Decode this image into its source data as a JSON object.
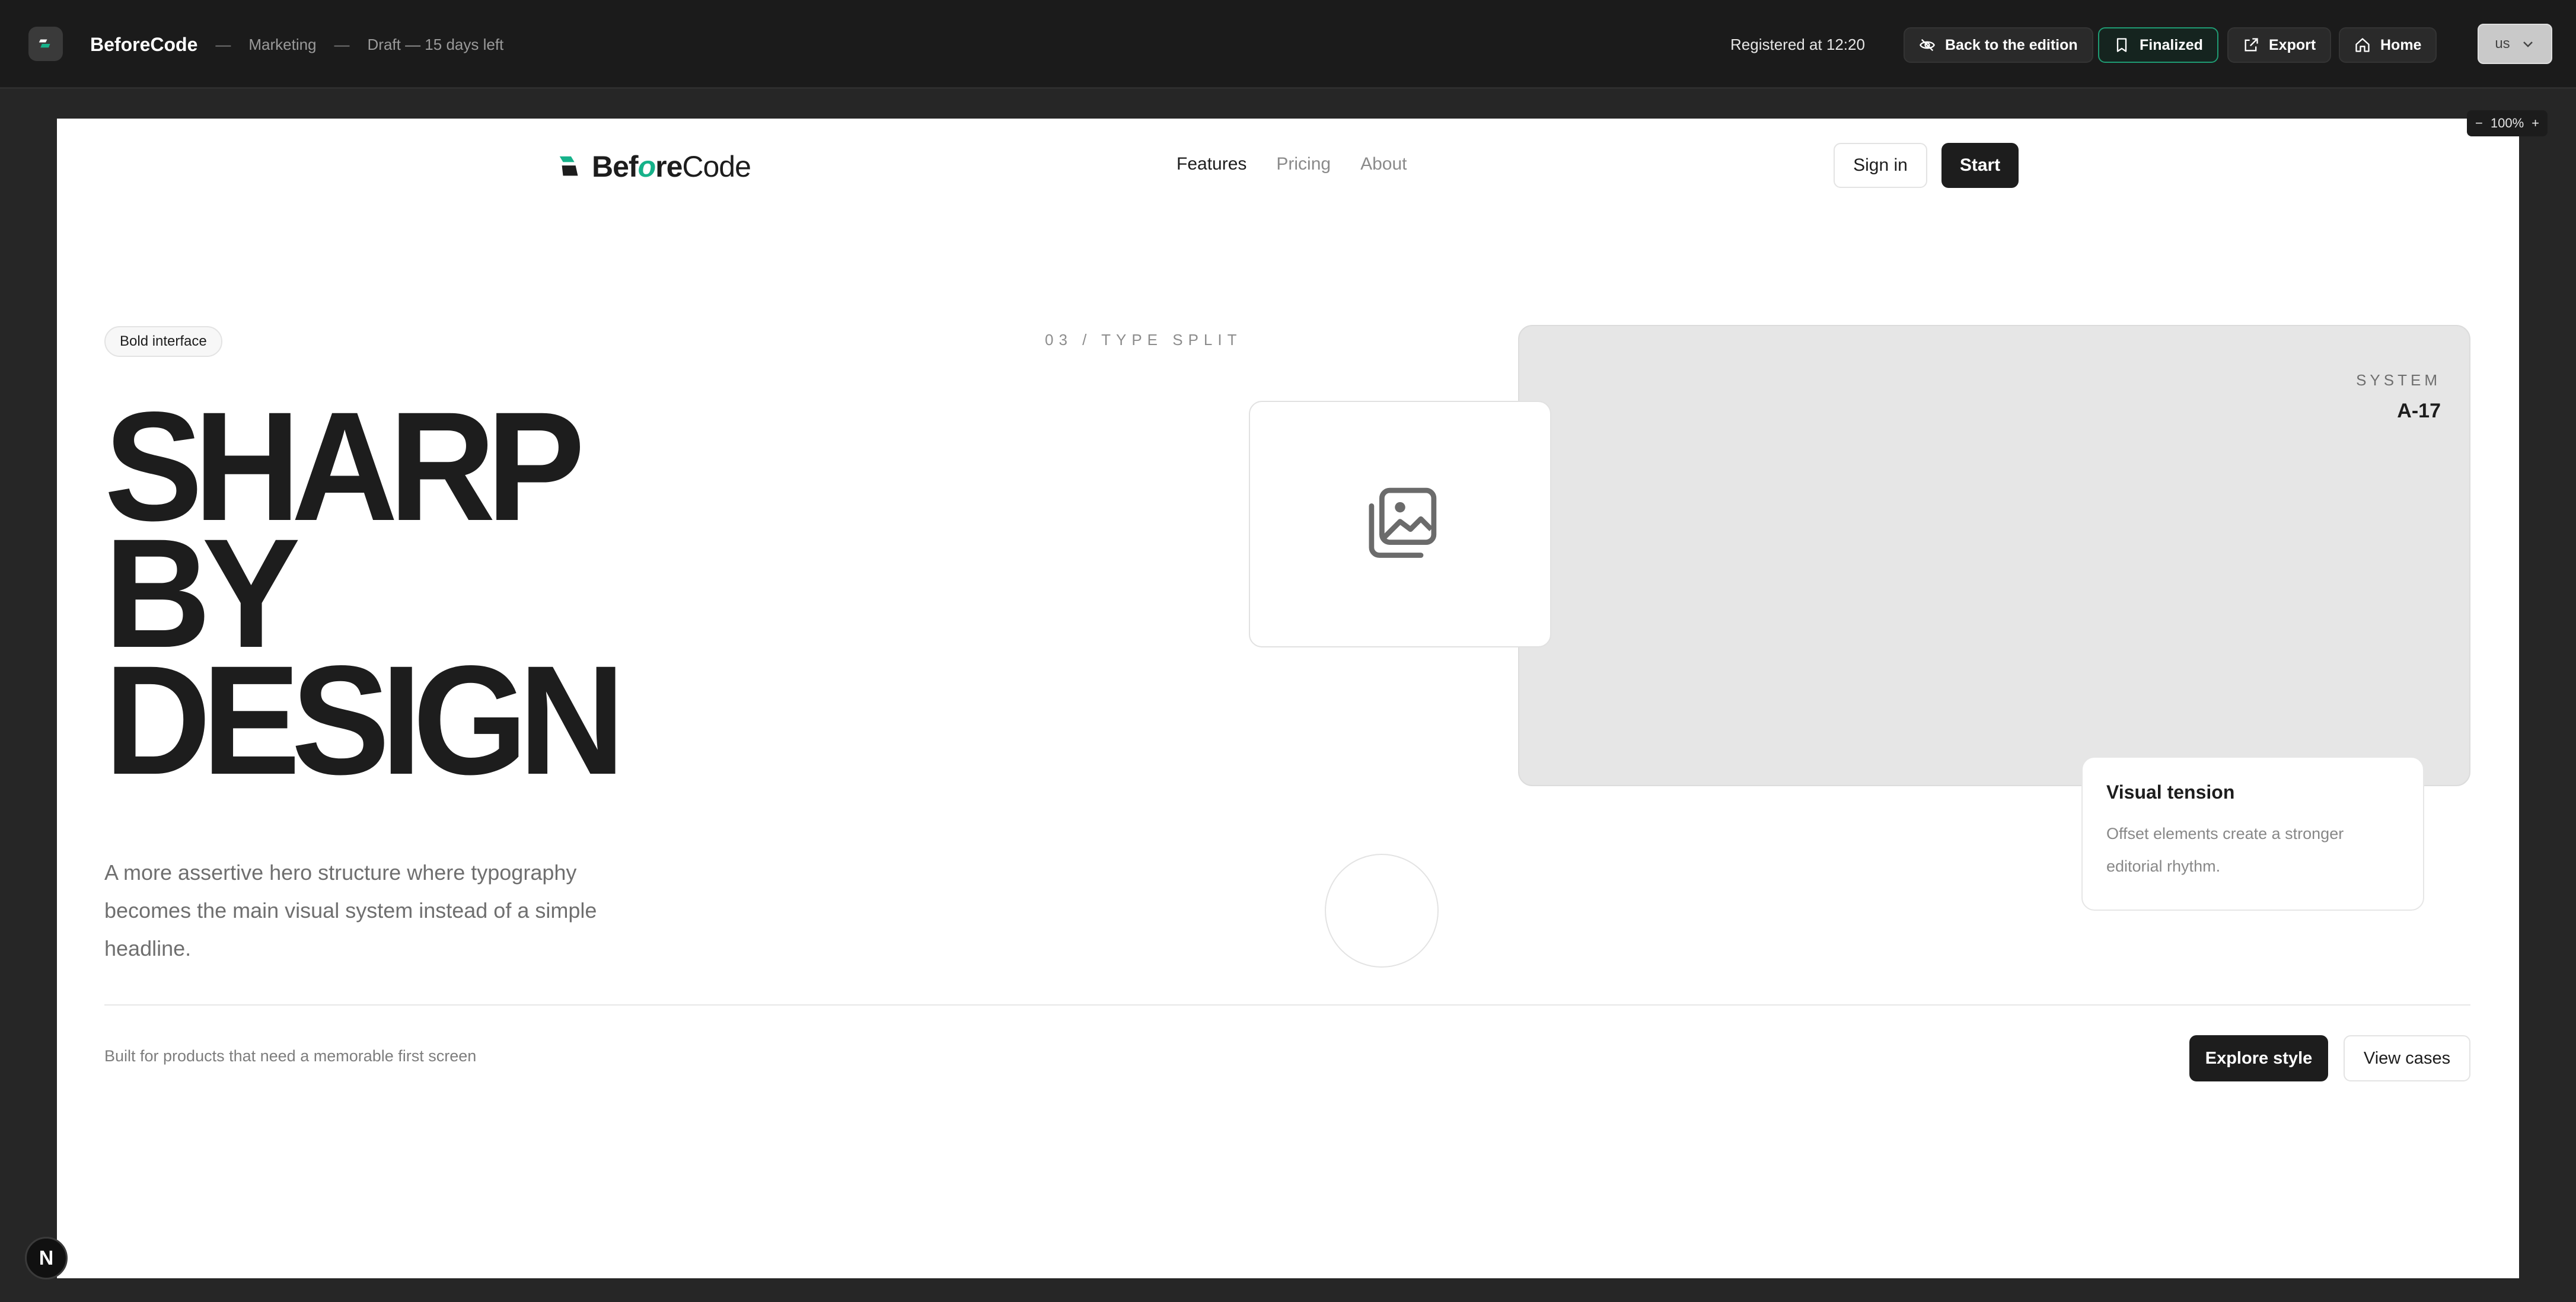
{
  "appbar": {
    "brand": "BeforeCode",
    "sep": "—",
    "section": "Marketing",
    "draft": "Draft — 15 days left",
    "registered": "Registered at 12:20",
    "buttons": {
      "back": "Back to the edition",
      "finalized": "Finalized",
      "export": "Export",
      "home": "Home"
    },
    "language": "us"
  },
  "zoom": {
    "minus": "−",
    "level": "100%",
    "plus": "+"
  },
  "site": {
    "logo_parts": [
      "Bef",
      "o",
      "re",
      "Code"
    ],
    "nav": [
      "Features",
      "Pricing",
      "About"
    ],
    "signin": "Sign in",
    "start": "Start"
  },
  "hero": {
    "pill": "Bold interface",
    "section_label": "03 / TYPE SPLIT",
    "headline": [
      "SHARP",
      "BY",
      "DESIGN"
    ],
    "lead": "A more assertive hero structure where typography becomes the main visual system instead of a simple headline.",
    "system_label": "SYSTEM",
    "system_code": "A-17",
    "note_title": "Visual tension",
    "note_body": "Offset elements create a stronger editorial rhythm."
  },
  "footer": {
    "text": "Built for products that need a memorable first screen",
    "explore": "Explore style",
    "view_cases": "View cases"
  },
  "badge": "N",
  "colors": {
    "accent": "#16b28a",
    "dark": "#1d1d1d",
    "appbar_bg": "#1b1b1b",
    "finalized_border": "#1f9b73"
  },
  "icons": [
    "app-logo-icon",
    "eye-off-icon",
    "bookmark-icon",
    "export-icon",
    "home-icon",
    "chevron-down-icon",
    "image-placeholder-icon"
  ]
}
